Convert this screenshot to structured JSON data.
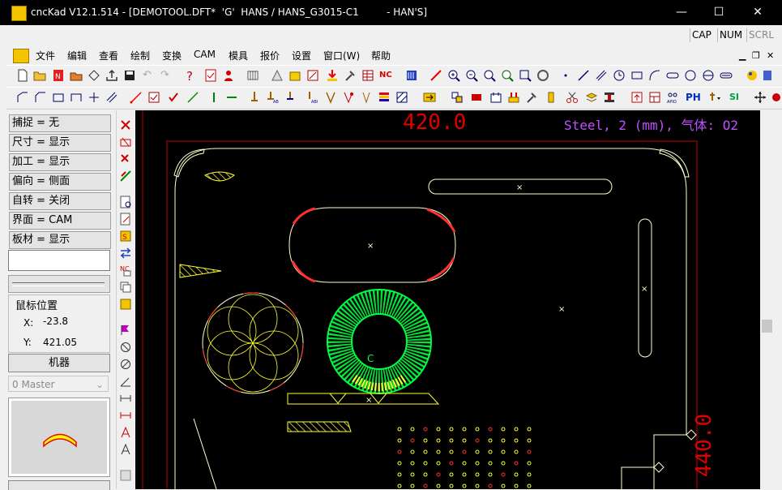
{
  "window": {
    "title": "cncKad V12.1.514 - [DEMOTOOL.DFT*  'G'  HANS / HANS_G3015-C1         - HAN'S]",
    "controls": {
      "minimize": "—",
      "maximize": "☐",
      "close": "✕"
    }
  },
  "indicators": [
    "CAP",
    "NUM",
    "SCRL"
  ],
  "menu": [
    "文件",
    "编辑",
    "查看",
    "绘制",
    "变换",
    "CAM",
    "模具",
    "报价",
    "设置",
    "窗口(W)",
    "帮助"
  ],
  "props": [
    {
      "label": "捕捉 = 无"
    },
    {
      "label": "尺寸 = 显示"
    },
    {
      "label": "加工 = 显示"
    },
    {
      "label": "偏向 = 侧面"
    },
    {
      "label": "自转 = 关闭"
    },
    {
      "label": "界面 = CAM"
    },
    {
      "label": "板材 = 显示"
    }
  ],
  "mouse": {
    "heading": "鼠标位置",
    "x_label": "X:",
    "x_value": "-23.8",
    "y_label": "Y:",
    "y_value": "421.05"
  },
  "machine_button": "机器",
  "master_select": "0 Master",
  "canvas": {
    "top_dimension": "420.0",
    "side_dimension": "440.0",
    "material_info": "Steel, 2 (mm), 气体: O2",
    "center_mark": "C"
  },
  "toolbar_text": {
    "nc": "NC",
    "ph": "PH",
    "si": "SI"
  },
  "colors": {
    "canvas_bg": "#000000",
    "part_outline": "#ffffcc",
    "dimension": "#e00000",
    "material_info": "#c050ff",
    "green_geometry": "#00ff40",
    "punch_yellow": "#ffff30"
  }
}
